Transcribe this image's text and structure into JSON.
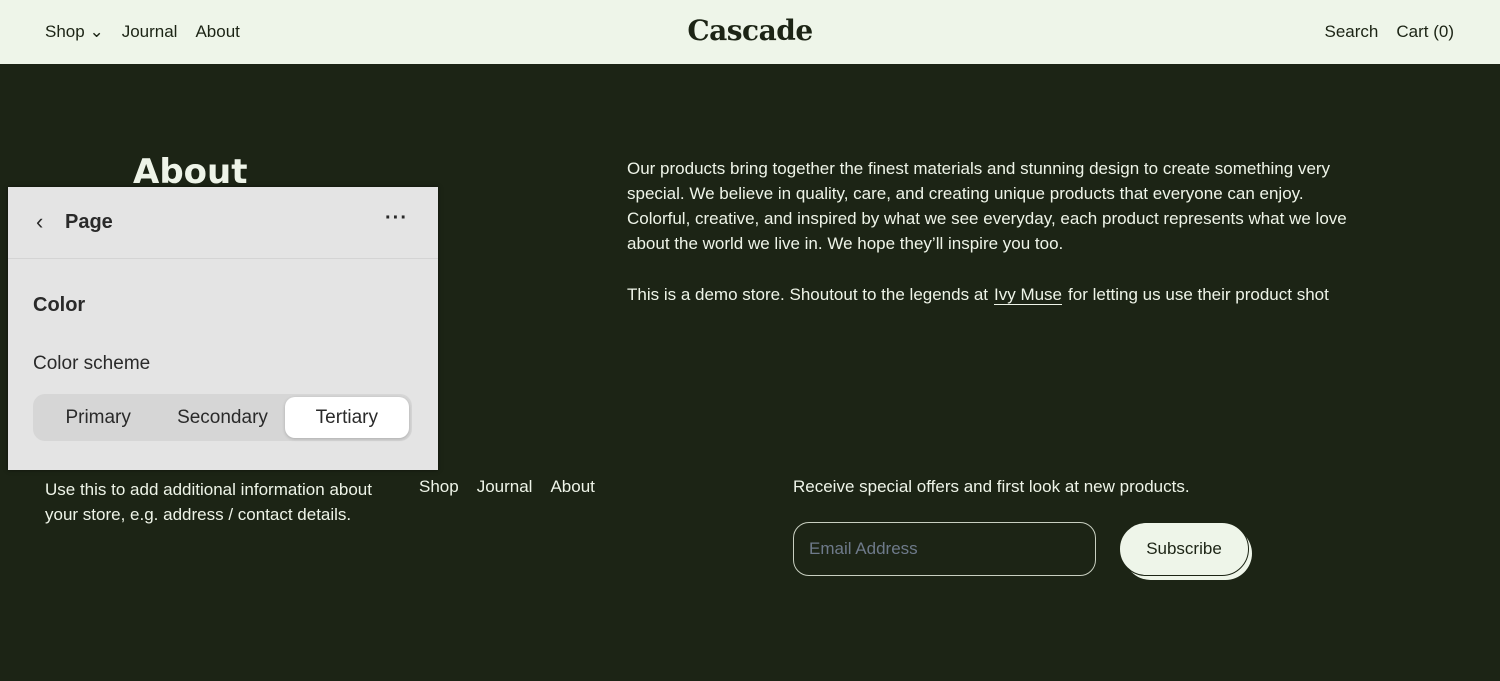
{
  "header": {
    "nav_left": [
      "Shop",
      "Journal",
      "About"
    ],
    "logo": "Cascade",
    "search": "Search",
    "cart": "Cart (0)"
  },
  "about": {
    "title": "About",
    "paragraph1": "Our products bring together the finest materials and stunning design to create something very special. We believe in quality, care, and creating unique products that everyone can enjoy. Colorful, creative, and inspired by what we see everyday, each product represents what we love about the world we live in. We hope they’ll inspire you too.",
    "p2_before": "This is a demo store. Shoutout to the legends at",
    "p2_link": "Ivy Muse",
    "p2_after": "for letting us use their product shot"
  },
  "footer": {
    "info": "Use this to add additional information about your store, e.g. address / contact details.",
    "nav": [
      "Shop",
      "Journal",
      "About"
    ],
    "newsletter": "Receive special offers and first look at new products.",
    "email_placeholder": "Email Address",
    "subscribe": "Subscribe"
  },
  "panel": {
    "title": "Page",
    "section": "Color",
    "label": "Color scheme",
    "options": [
      "Primary",
      "Secondary",
      "Tertiary"
    ],
    "selected": "Tertiary"
  }
}
